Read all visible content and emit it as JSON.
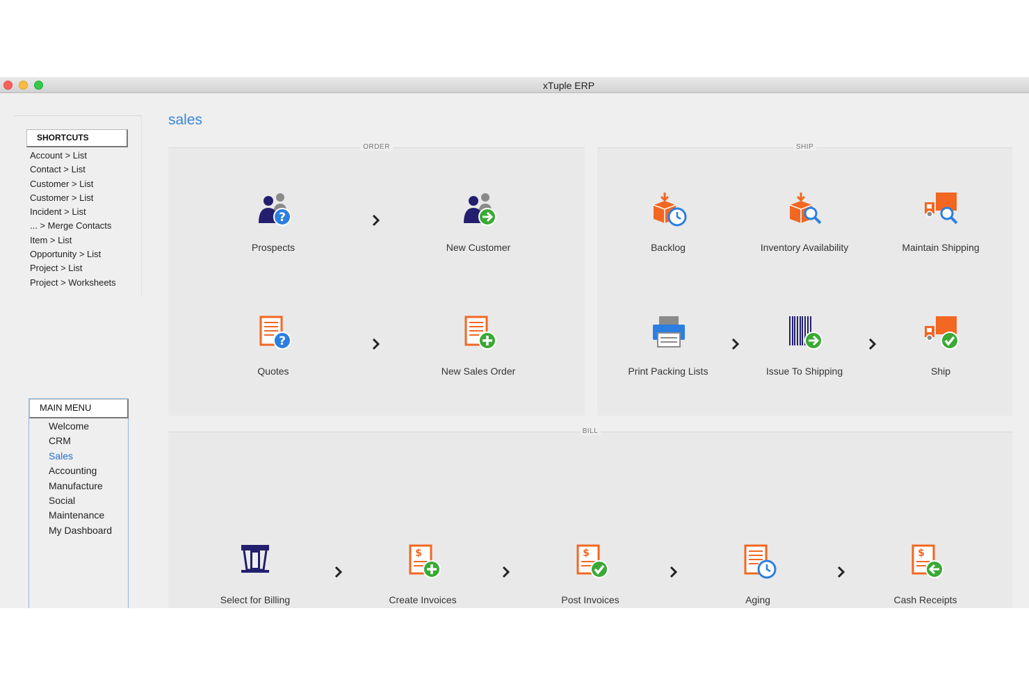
{
  "window": {
    "title": "xTuple ERP"
  },
  "page_title": "sales",
  "shortcuts": {
    "header": "SHORTCUTS",
    "items": [
      "Account > List",
      "Contact > List",
      "Customer > List",
      "Customer > List",
      "Incident > List",
      "... > Merge Contacts",
      "Item > List",
      "Opportunity > List",
      "Project > List",
      "Project > Worksheets"
    ]
  },
  "main_menu": {
    "header": "MAIN MENU",
    "items": [
      "Welcome",
      "CRM",
      "Sales",
      "Accounting",
      "Manufacture",
      "Social",
      "Maintenance",
      "My Dashboard"
    ],
    "active": "Sales"
  },
  "groups": {
    "order": {
      "label": "ORDER",
      "tiles": [
        "Prospects",
        "New Customer",
        "Quotes",
        "New Sales Order"
      ]
    },
    "ship": {
      "label": "SHIP",
      "tiles": [
        "Backlog",
        "Inventory Availability",
        "Maintain Shipping",
        "Print Packing Lists",
        "Issue To Shipping",
        "Ship"
      ]
    },
    "bill": {
      "label": "BILL",
      "tiles": [
        "Select for Billing",
        "Create Invoices",
        "Post Invoices",
        "Aging",
        "Cash Receipts"
      ]
    }
  },
  "icons": {
    "prospects": "people-question-icon",
    "new_customer": "people-add-arrow-icon",
    "quotes": "document-question-icon",
    "new_sales_order": "document-plus-icon",
    "backlog": "box-clock-icon",
    "inventory_availability": "box-search-icon",
    "maintain_shipping": "truck-search-icon",
    "print_packing_lists": "printer-icon",
    "issue_to_shipping": "barcode-arrow-icon",
    "ship": "truck-check-icon",
    "select_for_billing": "cash-register-icon",
    "create_invoices": "invoice-plus-icon",
    "post_invoices": "invoice-check-icon",
    "aging": "document-clock-icon",
    "cash_receipts": "invoice-back-arrow-icon"
  },
  "colors": {
    "accent": "#3a86d4",
    "orange": "#f26722",
    "navy": "#231f6e",
    "green": "#3aa935",
    "blue": "#2b7fe0",
    "gray": "#8a8a8a"
  }
}
